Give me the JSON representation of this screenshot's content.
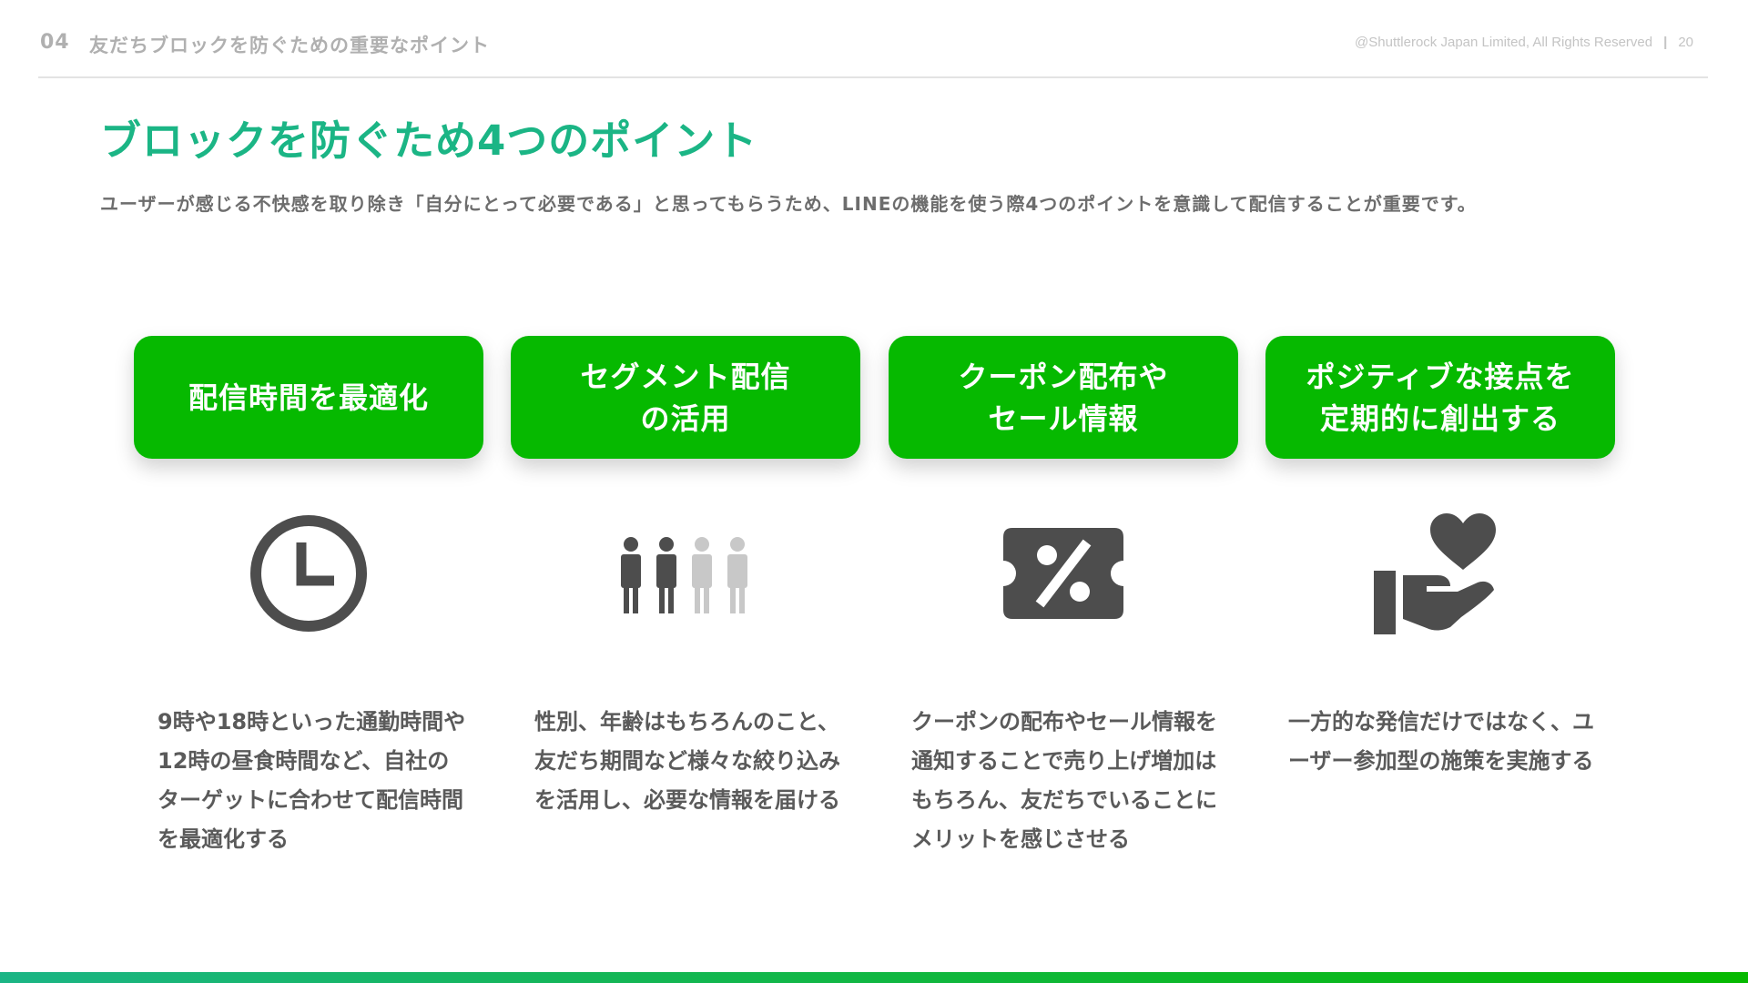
{
  "header": {
    "section_number": "04",
    "section_title": "友だちブロックを防ぐための重要なポイント",
    "copyright": "@Shuttlerock Japan Limited, All Rights Reserved",
    "separator": "|",
    "page_number": "20"
  },
  "title": "ブロックを防ぐため4つのポイント",
  "lead": "ユーザーが感じる不快感を取り除き「自分にとって必要である」と思ってもらうため、LINEの機能を使う際4つのポイントを意識して配信することが重要です。",
  "colors": {
    "title_green": "#1bb585",
    "card_green": "#06b900",
    "icon_gray": "#4d4d4d",
    "icon_light": "#c8c8c8"
  },
  "points": [
    {
      "label": "配信時間を最適化",
      "icon": "clock-icon",
      "description": "9時や18時といった通勤時間や12時の昼食時間など、自社のターゲットに合わせて配信時間を最適化する"
    },
    {
      "label": "セグメント配信\nの活用",
      "icon": "people-segment-icon",
      "description": "性別、年齢はもちろんのこと、友だち期間など様々な絞り込みを活用し、必要な情報を届ける"
    },
    {
      "label": "クーポン配布や\nセール情報",
      "icon": "coupon-percent-icon",
      "description": "クーポンの配布やセール情報を通知することで売り上げ増加はもちろん、友だちでいることにメリットを感じさせる"
    },
    {
      "label": "ポジティブな接点を\n定期的に創出する",
      "icon": "hand-heart-icon",
      "description": "一方的な発信だけではなく、ユーザー参加型の施策を実施する"
    }
  ]
}
